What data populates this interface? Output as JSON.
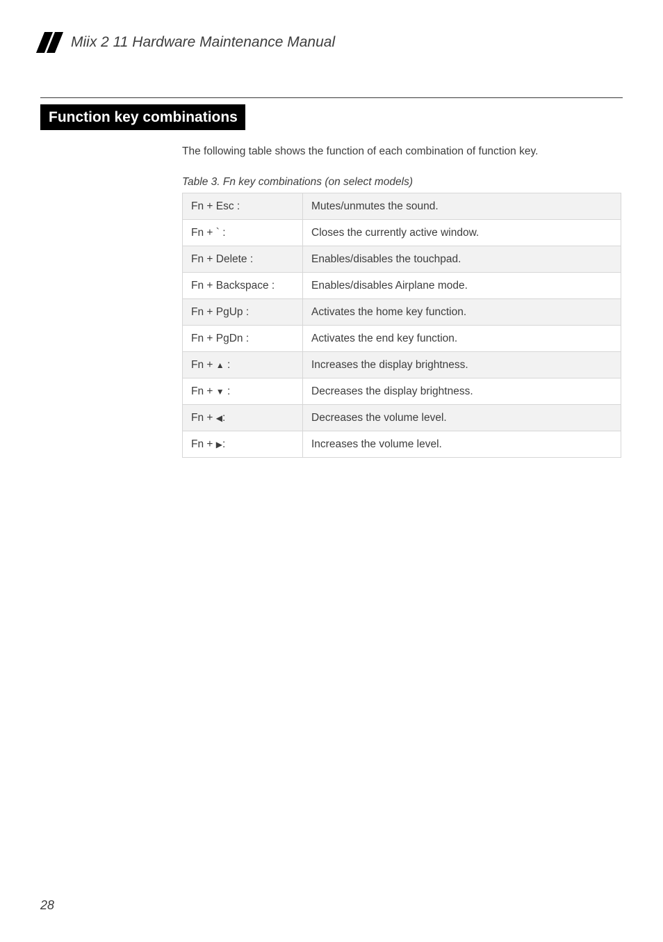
{
  "header": {
    "doc_title": "Miix 2 11 Hardware Maintenance Manual"
  },
  "section": {
    "heading": "Function key combinations"
  },
  "intro": "The following table shows the function of each combination of function key.",
  "table": {
    "caption": "Table 3. Fn key combinations (on select models)",
    "rows": [
      {
        "key": "Fn + Esc :",
        "desc": "Mutes/unmutes the sound."
      },
      {
        "key": "Fn + ` :",
        "desc": "Closes the currently active window."
      },
      {
        "key": "Fn + Delete :",
        "desc": "Enables/disables the touchpad."
      },
      {
        "key": "Fn + Backspace :",
        "desc": "Enables/disables Airplane mode."
      },
      {
        "key": "Fn + PgUp :",
        "desc": "Activates the home key function."
      },
      {
        "key": "Fn + PgDn :",
        "desc": "Activates the end key function."
      },
      {
        "key_pre": "Fn + ",
        "key_symbol": "▲",
        "key_post": " :",
        "desc": "Increases the display brightness."
      },
      {
        "key_pre": "Fn + ",
        "key_symbol": "▼",
        "key_post": " :",
        "desc": "Decreases the display brightness."
      },
      {
        "key_pre": "Fn + ",
        "key_symbol": "◀",
        "key_post": ":",
        "desc": "Decreases the volume level."
      },
      {
        "key_pre": "Fn + ",
        "key_symbol": "▶",
        "key_post": ":",
        "desc": "Increases the volume level."
      }
    ]
  },
  "page_number": "28"
}
